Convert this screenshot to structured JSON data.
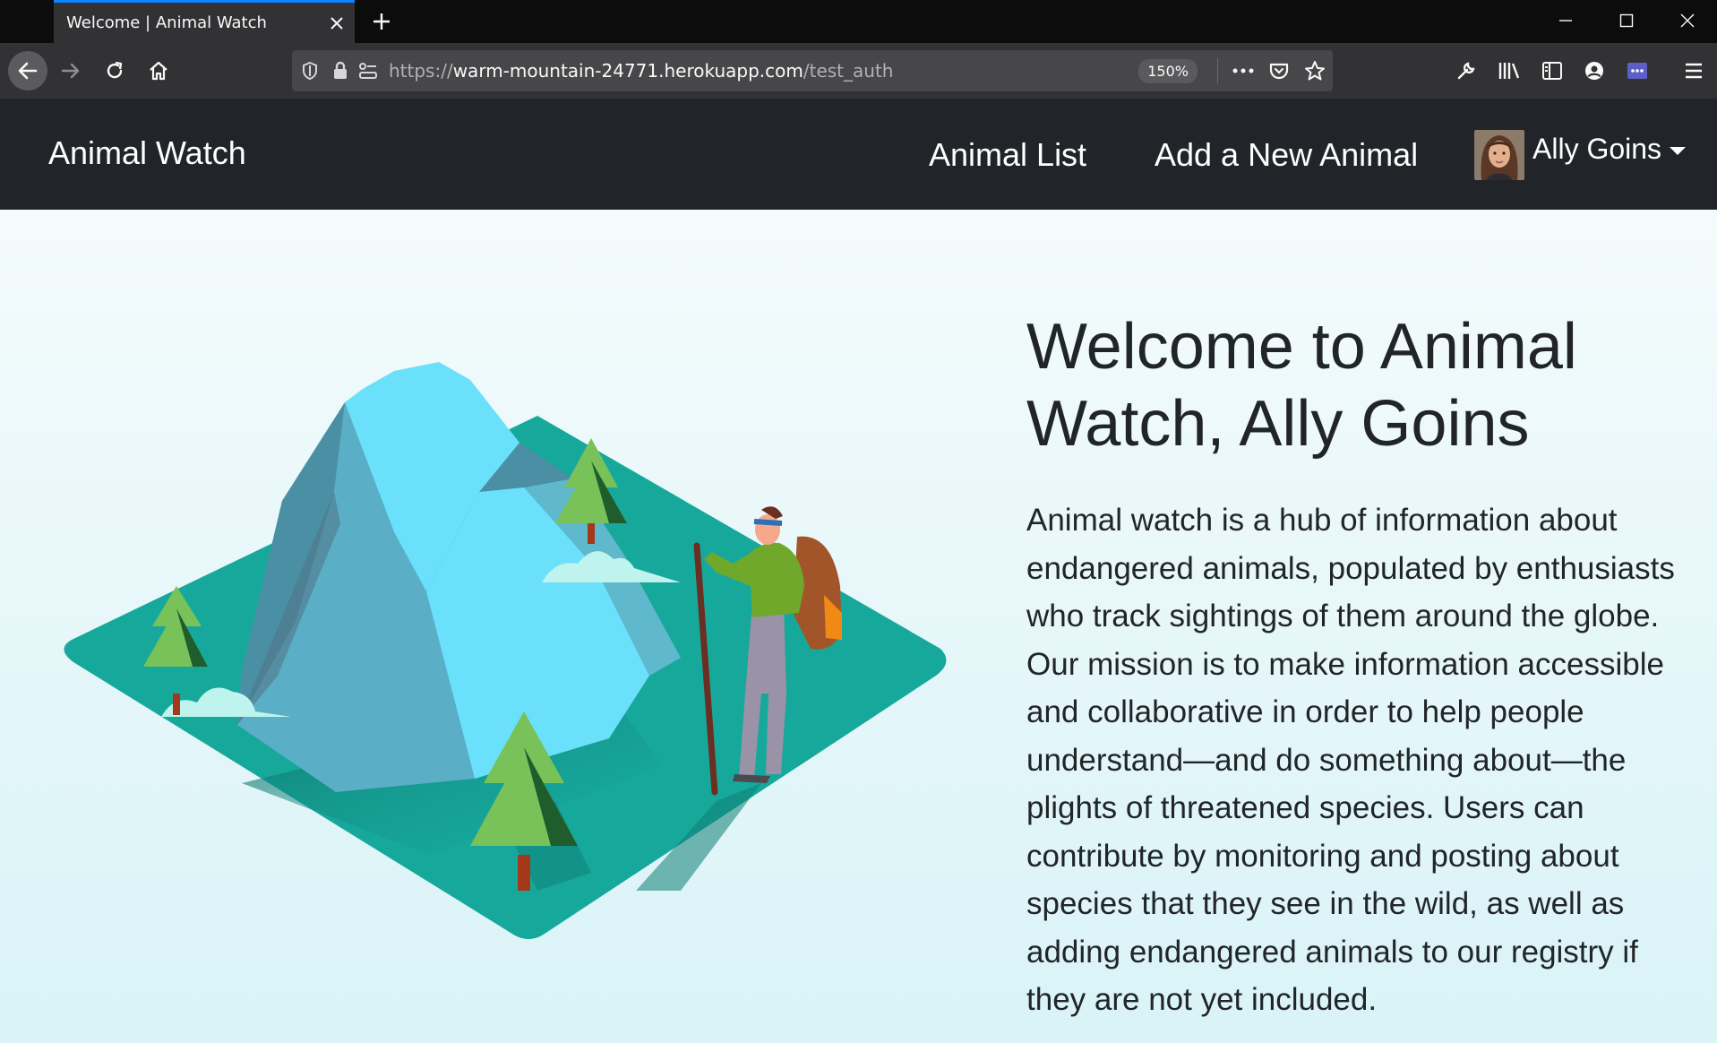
{
  "browser": {
    "tab_title": "Welcome | Animal Watch",
    "url_scheme": "https://",
    "url_host": "warm-mountain-24771.herokuapp.com",
    "url_path": "/test_auth",
    "zoom": "150%",
    "accent_color": "#0a84ff"
  },
  "nav": {
    "brand": "Animal Watch",
    "links": [
      "Animal List",
      "Add a New Animal"
    ],
    "user_name": "Ally Goins"
  },
  "hero": {
    "heading": "Welcome to Animal Watch, Ally Goins",
    "body": "Animal watch is a hub of information about endangered animals, populated by enthusiasts who track sightings of them around the globe. Our mission is to make information accessible and collaborative in order to help people understand—and do something about—the plights of threatened species. Users can contribute by monitoring and posting about species that they see in the wild, as well as adding endangered animals to our registry if they are not yet included."
  },
  "icons": {
    "tab_close": "close-icon",
    "new_tab": "plus-icon",
    "back": "arrow-left-icon",
    "forward": "arrow-right-icon",
    "reload": "reload-icon",
    "home": "home-icon",
    "shield": "shield-icon",
    "lock": "lock-icon",
    "permissions": "permissions-icon",
    "more": "more-icon",
    "pocket": "pocket-icon",
    "bookmark": "star-icon",
    "tools": "wrench-icon",
    "library": "library-icon",
    "sidebar": "sidebar-icon",
    "account": "account-icon",
    "extension": "extension-icon",
    "menu": "hamburger-icon"
  }
}
